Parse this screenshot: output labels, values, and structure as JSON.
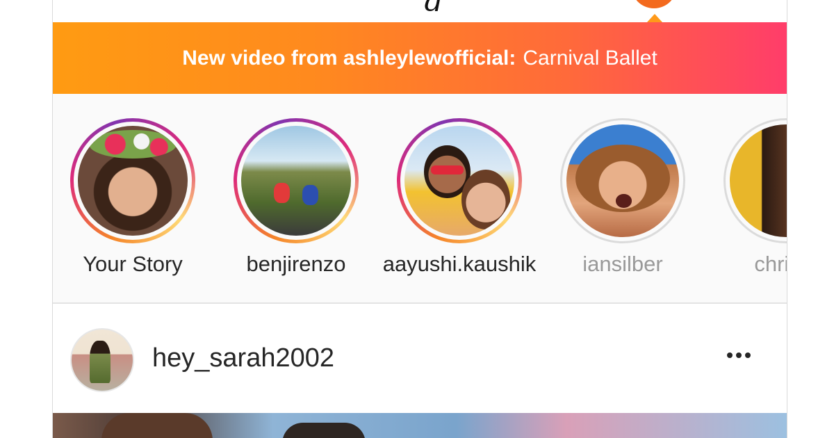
{
  "banner": {
    "lead": "New video from ashleylewofficial:",
    "video_title": "Carnival Ballet",
    "gradient_start": "#ff9b12",
    "gradient_end": "#ff3d6a"
  },
  "stories": [
    {
      "label": "Your Story",
      "seen": false
    },
    {
      "label": "benjirenzo",
      "seen": false
    },
    {
      "label": "aayushi.kaushik",
      "seen": false
    },
    {
      "label": "iansilber",
      "seen": true
    },
    {
      "label": "christe",
      "seen": true
    }
  ],
  "post": {
    "username": "hey_sarah2002",
    "more_icon": "more-horizontal-icon"
  },
  "colors": {
    "text_primary": "#262626",
    "text_seen": "#999999",
    "ring_seen": "#dbdbdb"
  }
}
